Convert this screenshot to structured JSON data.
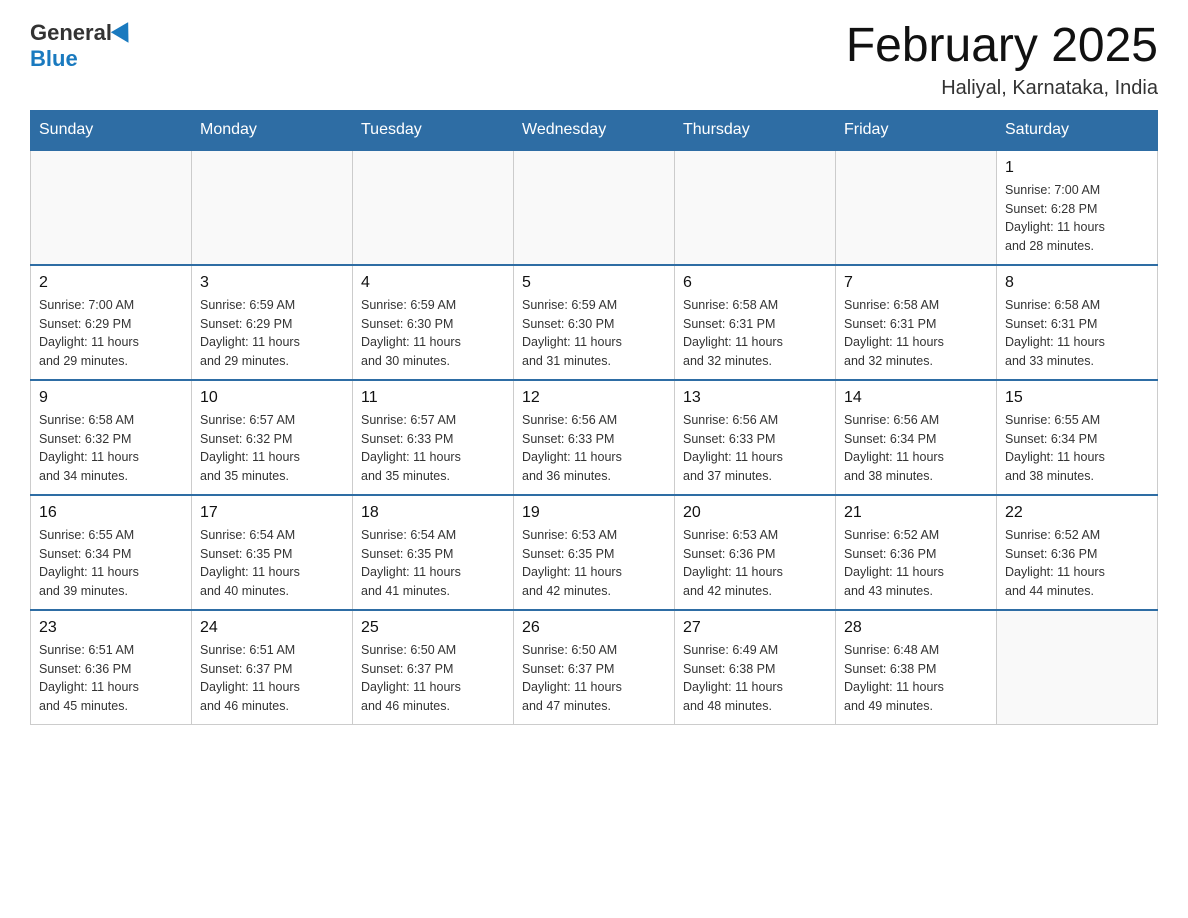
{
  "header": {
    "logo_general": "General",
    "logo_blue": "Blue",
    "title": "February 2025",
    "subtitle": "Haliyal, Karnataka, India"
  },
  "weekdays": [
    "Sunday",
    "Monday",
    "Tuesday",
    "Wednesday",
    "Thursday",
    "Friday",
    "Saturday"
  ],
  "weeks": [
    [
      {
        "day": "",
        "info": ""
      },
      {
        "day": "",
        "info": ""
      },
      {
        "day": "",
        "info": ""
      },
      {
        "day": "",
        "info": ""
      },
      {
        "day": "",
        "info": ""
      },
      {
        "day": "",
        "info": ""
      },
      {
        "day": "1",
        "info": "Sunrise: 7:00 AM\nSunset: 6:28 PM\nDaylight: 11 hours\nand 28 minutes."
      }
    ],
    [
      {
        "day": "2",
        "info": "Sunrise: 7:00 AM\nSunset: 6:29 PM\nDaylight: 11 hours\nand 29 minutes."
      },
      {
        "day": "3",
        "info": "Sunrise: 6:59 AM\nSunset: 6:29 PM\nDaylight: 11 hours\nand 29 minutes."
      },
      {
        "day": "4",
        "info": "Sunrise: 6:59 AM\nSunset: 6:30 PM\nDaylight: 11 hours\nand 30 minutes."
      },
      {
        "day": "5",
        "info": "Sunrise: 6:59 AM\nSunset: 6:30 PM\nDaylight: 11 hours\nand 31 minutes."
      },
      {
        "day": "6",
        "info": "Sunrise: 6:58 AM\nSunset: 6:31 PM\nDaylight: 11 hours\nand 32 minutes."
      },
      {
        "day": "7",
        "info": "Sunrise: 6:58 AM\nSunset: 6:31 PM\nDaylight: 11 hours\nand 32 minutes."
      },
      {
        "day": "8",
        "info": "Sunrise: 6:58 AM\nSunset: 6:31 PM\nDaylight: 11 hours\nand 33 minutes."
      }
    ],
    [
      {
        "day": "9",
        "info": "Sunrise: 6:58 AM\nSunset: 6:32 PM\nDaylight: 11 hours\nand 34 minutes."
      },
      {
        "day": "10",
        "info": "Sunrise: 6:57 AM\nSunset: 6:32 PM\nDaylight: 11 hours\nand 35 minutes."
      },
      {
        "day": "11",
        "info": "Sunrise: 6:57 AM\nSunset: 6:33 PM\nDaylight: 11 hours\nand 35 minutes."
      },
      {
        "day": "12",
        "info": "Sunrise: 6:56 AM\nSunset: 6:33 PM\nDaylight: 11 hours\nand 36 minutes."
      },
      {
        "day": "13",
        "info": "Sunrise: 6:56 AM\nSunset: 6:33 PM\nDaylight: 11 hours\nand 37 minutes."
      },
      {
        "day": "14",
        "info": "Sunrise: 6:56 AM\nSunset: 6:34 PM\nDaylight: 11 hours\nand 38 minutes."
      },
      {
        "day": "15",
        "info": "Sunrise: 6:55 AM\nSunset: 6:34 PM\nDaylight: 11 hours\nand 38 minutes."
      }
    ],
    [
      {
        "day": "16",
        "info": "Sunrise: 6:55 AM\nSunset: 6:34 PM\nDaylight: 11 hours\nand 39 minutes."
      },
      {
        "day": "17",
        "info": "Sunrise: 6:54 AM\nSunset: 6:35 PM\nDaylight: 11 hours\nand 40 minutes."
      },
      {
        "day": "18",
        "info": "Sunrise: 6:54 AM\nSunset: 6:35 PM\nDaylight: 11 hours\nand 41 minutes."
      },
      {
        "day": "19",
        "info": "Sunrise: 6:53 AM\nSunset: 6:35 PM\nDaylight: 11 hours\nand 42 minutes."
      },
      {
        "day": "20",
        "info": "Sunrise: 6:53 AM\nSunset: 6:36 PM\nDaylight: 11 hours\nand 42 minutes."
      },
      {
        "day": "21",
        "info": "Sunrise: 6:52 AM\nSunset: 6:36 PM\nDaylight: 11 hours\nand 43 minutes."
      },
      {
        "day": "22",
        "info": "Sunrise: 6:52 AM\nSunset: 6:36 PM\nDaylight: 11 hours\nand 44 minutes."
      }
    ],
    [
      {
        "day": "23",
        "info": "Sunrise: 6:51 AM\nSunset: 6:36 PM\nDaylight: 11 hours\nand 45 minutes."
      },
      {
        "day": "24",
        "info": "Sunrise: 6:51 AM\nSunset: 6:37 PM\nDaylight: 11 hours\nand 46 minutes."
      },
      {
        "day": "25",
        "info": "Sunrise: 6:50 AM\nSunset: 6:37 PM\nDaylight: 11 hours\nand 46 minutes."
      },
      {
        "day": "26",
        "info": "Sunrise: 6:50 AM\nSunset: 6:37 PM\nDaylight: 11 hours\nand 47 minutes."
      },
      {
        "day": "27",
        "info": "Sunrise: 6:49 AM\nSunset: 6:38 PM\nDaylight: 11 hours\nand 48 minutes."
      },
      {
        "day": "28",
        "info": "Sunrise: 6:48 AM\nSunset: 6:38 PM\nDaylight: 11 hours\nand 49 minutes."
      },
      {
        "day": "",
        "info": ""
      }
    ]
  ]
}
